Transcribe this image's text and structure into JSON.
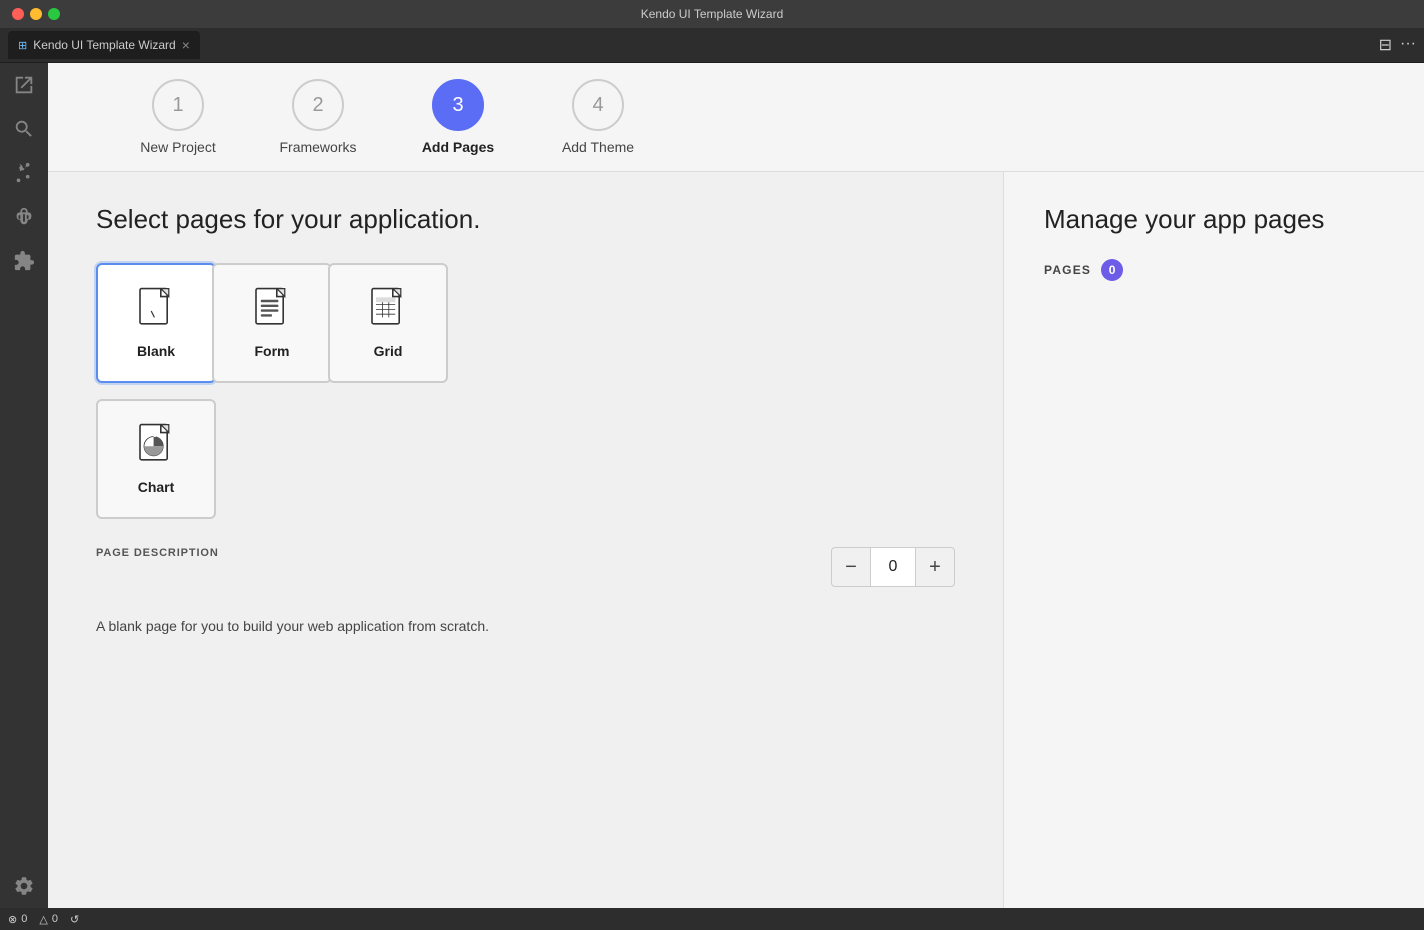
{
  "titleBar": {
    "title": "Kendo UI Template Wizard",
    "tabLabel": "Kendo UI Template Wizard",
    "tabIcon": "⊞"
  },
  "wizardSteps": [
    {
      "number": "1",
      "label": "New Project",
      "active": false
    },
    {
      "number": "2",
      "label": "Frameworks",
      "active": false
    },
    {
      "number": "3",
      "label": "Add Pages",
      "active": true
    },
    {
      "number": "4",
      "label": "Add Theme",
      "active": false
    }
  ],
  "leftPanel": {
    "title": "Select pages for your application.",
    "pageTypes": [
      {
        "id": "blank",
        "label": "Blank",
        "selected": true
      },
      {
        "id": "form",
        "label": "Form",
        "selected": false
      },
      {
        "id": "grid",
        "label": "Grid",
        "selected": false
      },
      {
        "id": "chart",
        "label": "Chart",
        "selected": false
      }
    ],
    "descriptionLabel": "PAGE DESCRIPTION",
    "quantity": "0",
    "descriptionText": "A blank page for you to build your web\napplication from scratch."
  },
  "rightPanel": {
    "title": "Manage your app pages",
    "pagesLabel": "PAGES",
    "pagesCount": "0"
  },
  "bottomBar": {
    "errors": "0",
    "warnings": "0",
    "timeLabel": ""
  },
  "buttons": {
    "minus": "−",
    "plus": "+"
  }
}
